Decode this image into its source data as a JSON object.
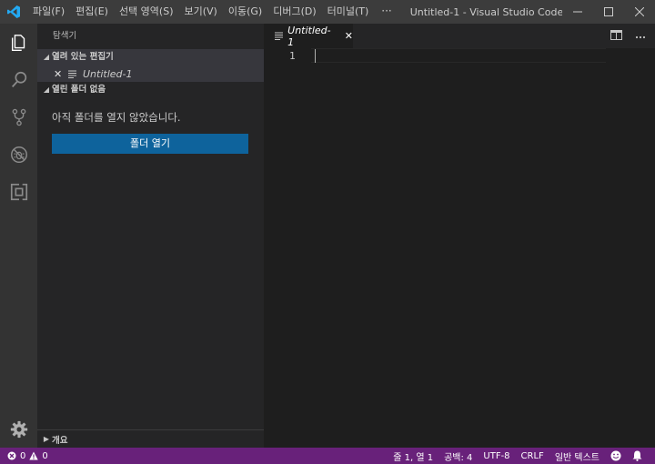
{
  "titlebar": {
    "menu": [
      "파일(F)",
      "편집(E)",
      "선택 영역(S)",
      "보기(V)",
      "이동(G)",
      "디버그(D)",
      "터미널(T)"
    ],
    "more": "···",
    "window_title": "Untitled-1 - Visual Studio Code [...",
    "controls": {
      "minimize": "─",
      "maximize": "☐",
      "close": "✕"
    }
  },
  "activitybar": {
    "icons": [
      "files-icon",
      "search-icon",
      "source-control-icon",
      "debug-icon",
      "extensions-icon"
    ],
    "bottom_icon": "gear-icon"
  },
  "sidebar": {
    "title": "탐색기",
    "open_editors": {
      "label": "열려 있는 편집기",
      "items": [
        {
          "close": "✕",
          "name": "Untitled-1"
        }
      ]
    },
    "no_folder": {
      "label": "열린 폴더 없음",
      "message": "아직 폴더를 열지 않았습니다.",
      "button": "폴더 열기"
    },
    "outline": {
      "label": "개요"
    }
  },
  "editor": {
    "tab": {
      "label": "Untitled-1",
      "close": "✕"
    },
    "line_numbers": [
      "1"
    ]
  },
  "statusbar": {
    "errors": "0",
    "warnings": "0",
    "position": "줄 1, 열 1",
    "indent": "공백: 4",
    "encoding": "UTF-8",
    "eol": "CRLF",
    "language": "일반 텍스트"
  },
  "colors": {
    "titlebar": "#3c3c3c",
    "activitybar": "#333333",
    "sidebar": "#252526",
    "editor": "#1e1e1e",
    "statusbar": "#68217a",
    "button": "#0e639c",
    "vscode_blue": "#23a9f2"
  }
}
